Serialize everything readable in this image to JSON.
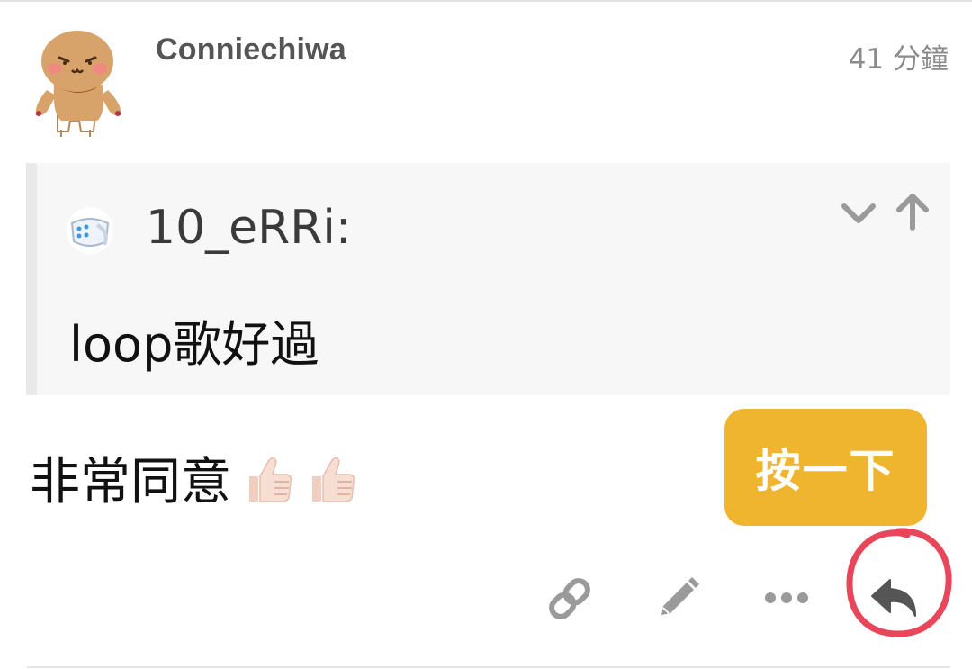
{
  "post": {
    "author": "Conniechiwa",
    "time_ago": "41 分鐘",
    "author_avatar_icon": "gingerbread-bear-avatar-icon",
    "body_text": "非常同意",
    "body_emoji": [
      "thumbs-up-icon",
      "thumbs-up-icon"
    ]
  },
  "quote": {
    "author": "10_eRRi:",
    "avatar_icon": "diaper-avatar-icon",
    "text": "loop歌好過",
    "expand_icon": "chevron-down-icon",
    "jump_icon": "arrow-up-icon"
  },
  "overlay": {
    "hint_label": "按一下",
    "hint_color": "#f0b52e",
    "highlight_color": "#e8465a"
  },
  "actions": [
    {
      "name": "link",
      "icon": "link-icon"
    },
    {
      "name": "edit",
      "icon": "pencil-icon"
    },
    {
      "name": "more",
      "icon": "ellipsis-icon"
    },
    {
      "name": "reply",
      "icon": "reply-arrow-icon"
    }
  ],
  "colors": {
    "icon_gray": "#9a9a9a",
    "reply_icon": "#555555",
    "quote_bg": "#f7f7f7",
    "quote_border": "#e9e9e9"
  }
}
